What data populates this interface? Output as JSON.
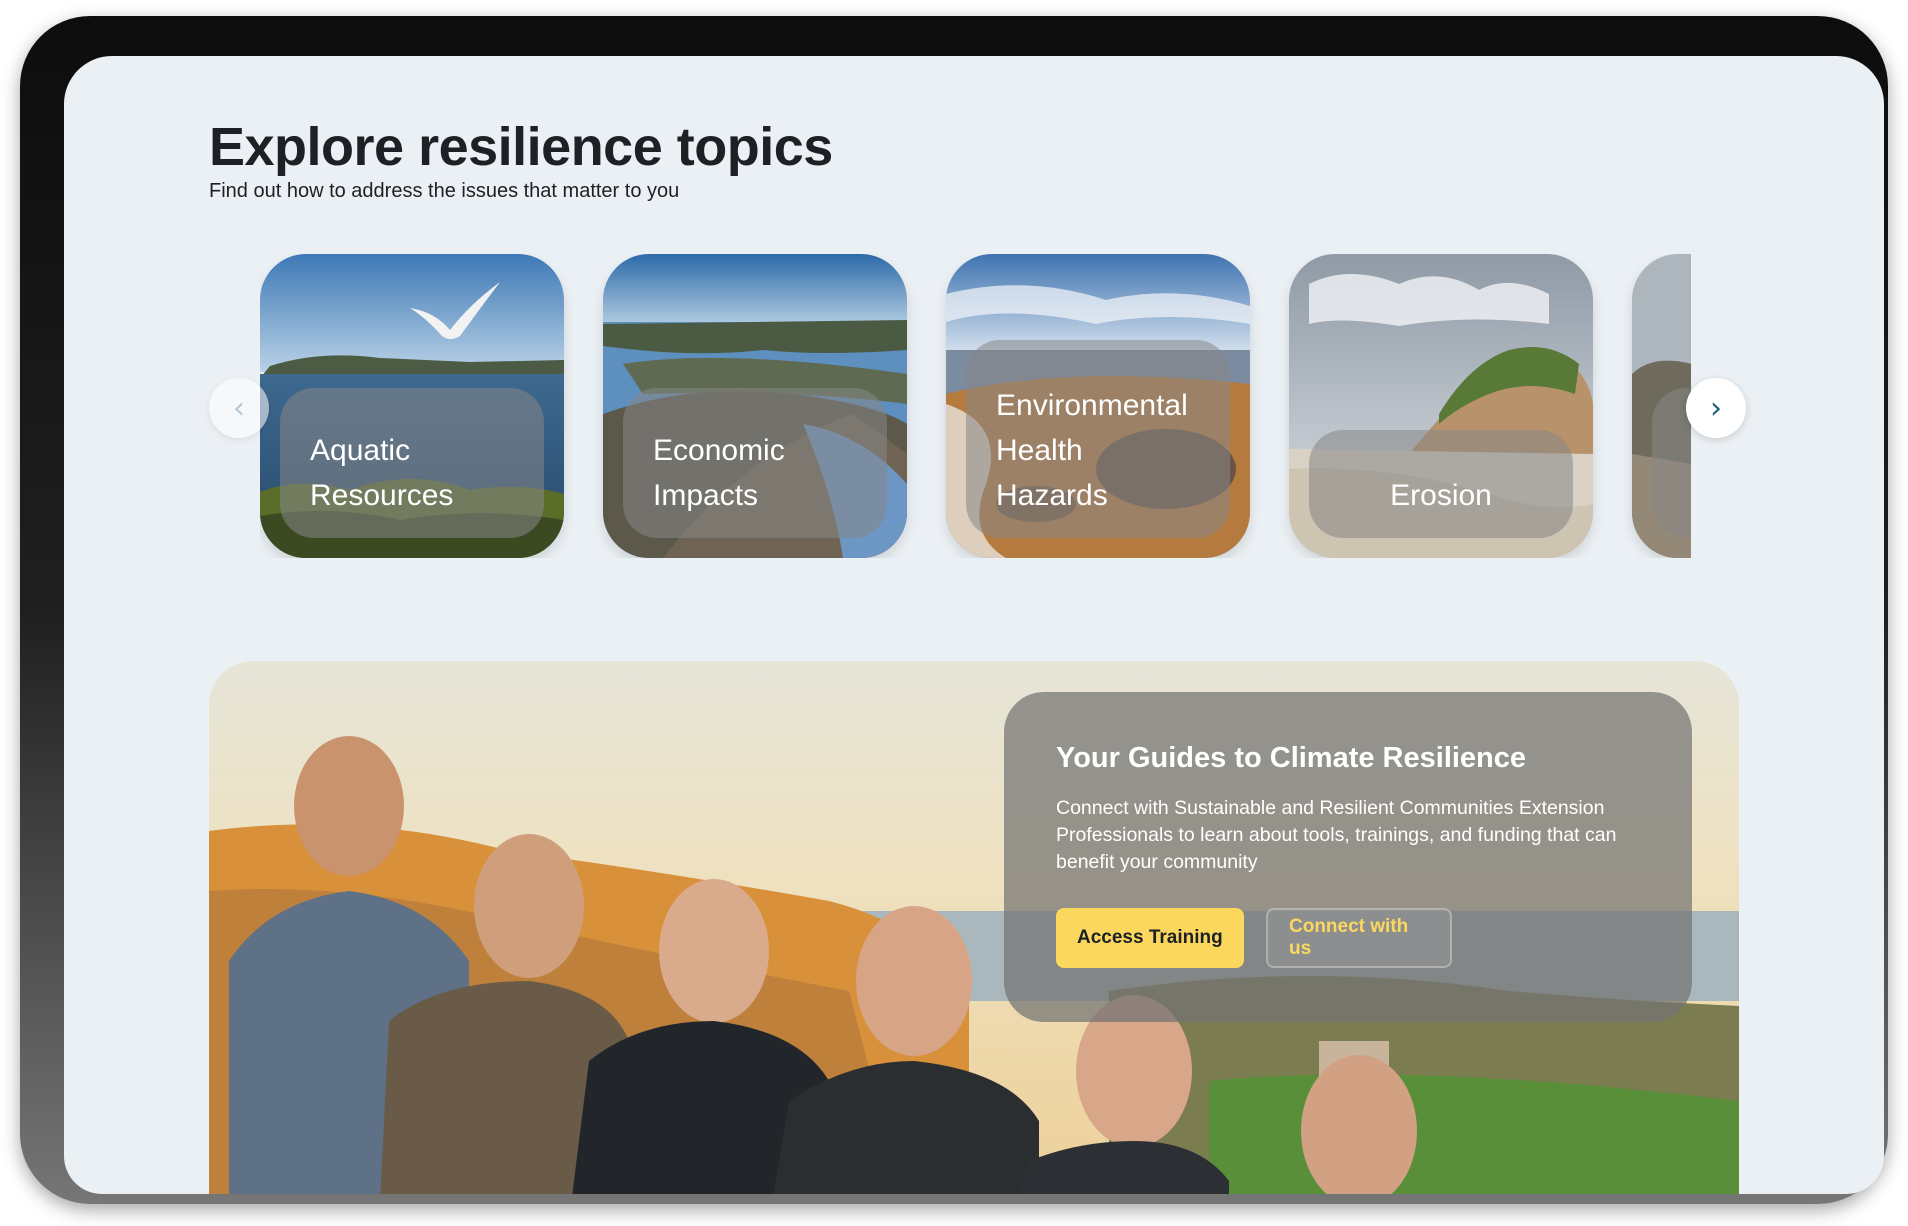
{
  "section": {
    "title": "Explore resilience topics",
    "subtitle": "Find out how to address the issues that matter to you"
  },
  "carousel": {
    "cards": [
      {
        "label": "Aquatic Resources"
      },
      {
        "label": "Economic Impacts"
      },
      {
        "label": "Environmental Health Hazards"
      },
      {
        "label": "Erosion"
      },
      {
        "label": ""
      }
    ]
  },
  "guides": {
    "heading": "Your Guides to Climate Resilience",
    "body": "Connect with Sustainable and Resilient Communities Extension Professionals to learn about tools, trainings, and funding that can benefit your community",
    "primary_button": "Access Training",
    "secondary_button": "Connect with us"
  },
  "icons": {
    "prev": "chevron-left-icon",
    "next": "chevron-right-icon"
  },
  "colors": {
    "page_background": "#ebf0f4",
    "accent_yellow": "#fbd85d",
    "heading_text": "#1d2125",
    "arrow_accent": "#1a5f7a"
  }
}
